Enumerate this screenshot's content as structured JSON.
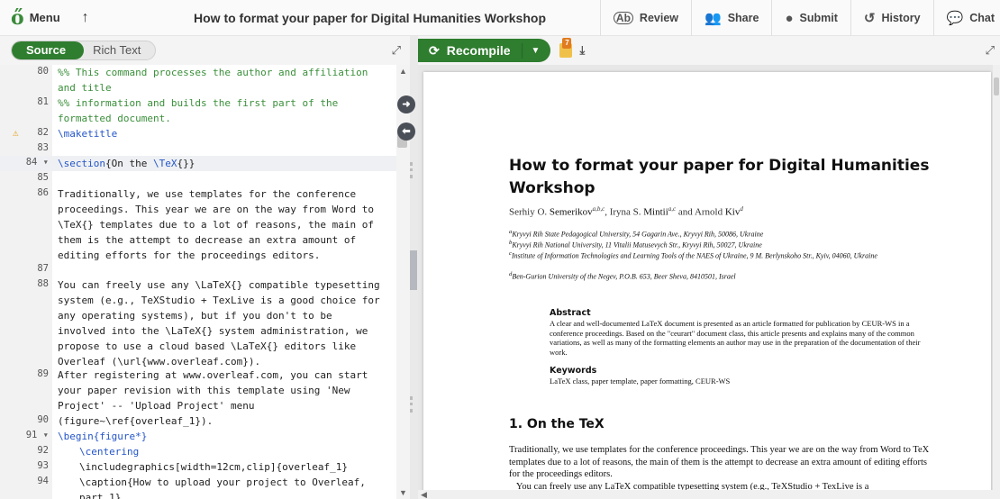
{
  "toolbar": {
    "menu_label": "Menu",
    "title": "How to format your paper for Digital Humanities Workshop",
    "review_label": "Review",
    "share_label": "Share",
    "submit_label": "Submit",
    "history_label": "History",
    "chat_label": "Chat"
  },
  "editor": {
    "source_tab": "Source",
    "rich_text_tab": "Rich Text",
    "lines": [
      {
        "n": "80",
        "text": "%% This command processes the author and affiliation and title"
      },
      {
        "n": "81",
        "text": "%% information and builds the first part of the formatted document."
      },
      {
        "n": "82",
        "text": "\\maketitle"
      },
      {
        "n": "83",
        "text": ""
      },
      {
        "n": "84",
        "text": "\\section{On the \\TeX{}}"
      },
      {
        "n": "85",
        "text": ""
      },
      {
        "n": "86",
        "text": "Traditionally, we use templates for the conference proceedings. This year we are on the way from Word to \\TeX{} templates due to a lot of reasons, the main of them is the attempt to decrease an extra amount of editing efforts for the proceedings editors."
      },
      {
        "n": "87",
        "text": ""
      },
      {
        "n": "88",
        "text": "You can freely use any \\LaTeX{} compatible typesetting system (e.g., TeXStudio + TexLive is a good choice for any operating systems), but if you don't to be involved into the \\LaTeX{} system administration, we propose to use a cloud based \\LaTeX{} editors like Overleaf (\\url{www.overleaf.com})."
      },
      {
        "n": "89",
        "text": "After registering at www.overleaf.com, you can start your paper revision with this template using 'New Project' -- 'Upload Project' menu (figure~\\ref{overleaf_1})."
      },
      {
        "n": "90",
        "text": ""
      },
      {
        "n": "91",
        "text": "\\begin{figure*}"
      },
      {
        "n": "92",
        "text": "\\centering"
      },
      {
        "n": "93",
        "text": "\\includegraphics[width=12cm,clip]{overleaf_1}"
      },
      {
        "n": "94",
        "text": "\\caption{How to upload your project to Overleaf, part 1}"
      }
    ]
  },
  "pdf": {
    "recompile_label": "Recompile",
    "log_count": "7",
    "title": "How to format your paper for Digital Humanities Workshop",
    "authors": [
      {
        "first": "Serhiy O.",
        "last": "Semerikov",
        "sup": "a,b,c"
      },
      {
        "first": "Iryna S.",
        "last": "Mintii",
        "sup": "a,c"
      },
      {
        "first": "Arnold",
        "last": "Kiv",
        "sup": "d"
      }
    ],
    "affiliations": [
      {
        "sup": "a",
        "text": "Kryvyi Rih State Pedagogical University, 54 Gagarin Ave., Kryvyi Rih, 50086, Ukraine"
      },
      {
        "sup": "b",
        "text": "Kryvyi Rih National University, 11 Vitalii Matusevych Str., Kryvyi Rih, 50027, Ukraine"
      },
      {
        "sup": "c",
        "text": "Institute of Information Technologies and Learning Tools of the NAES of Ukraine, 9 M. Berlynskoho Str., Kyiv, 04060, Ukraine"
      },
      {
        "sup": "d",
        "text": "Ben-Gurion University of the Negev, P.O.B. 653, Beer Sheva, 8410501, Israel"
      }
    ],
    "abstract_heading": "Abstract",
    "abstract_text": "A clear and well-documented LaTeX document is presented as an article formatted for publication by CEUR-WS in a conference proceedings. Based on the \"ceurart\" document class, this article presents and explains many of the common variations, as well as many of the formatting elements an author may use in the preparation of the documentation of their work.",
    "keywords_heading": "Keywords",
    "keywords_text": "LaTeX class, paper template, paper formatting, CEUR-WS",
    "section_heading": "1. On the TeX",
    "section_text": "Traditionally, we use templates for the conference proceedings. This year we are on the way from Word to TeX templates due to a lot of reasons, the main of them is the attempt to decrease an extra amount of editing efforts for the proceedings editors.",
    "section_text_2": "You can freely use any LaTeX compatible typesetting system (e.g., TeXStudio + TexLive is a"
  }
}
